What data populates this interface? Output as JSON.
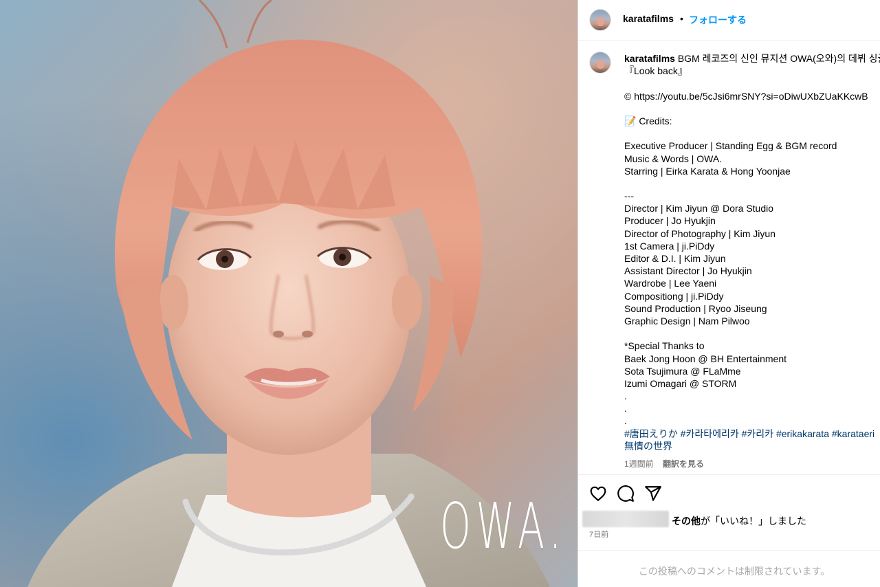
{
  "post": {
    "image_overlay_text": "OWA."
  },
  "header": {
    "username": "karatafilms",
    "separator": "•",
    "follow_label": "フォローする"
  },
  "caption": {
    "username": "karatafilms",
    "first_line": " BGM 레코즈의 신인 뮤지션 OWA(오와)의 데뷔 싱글",
    "lines": [
      "『Look back』",
      "",
      "© https://youtu.be/5cJsi6mrSNY?si=oDiwUXbZUaKKcwB",
      "",
      "📝 Credits:",
      "",
      "Executive Producer | Standing Egg & BGM record",
      "Music & Words | OWA.",
      "Starring | Eirka Karata & Hong Yoonjae",
      "",
      "---",
      "Director | Kim Jiyun @ Dora Studio",
      "Producer | Jo Hyukjin",
      "Director of Photography | Kim Jiyun",
      "1st Camera | ji.PiDdy",
      "Editor & D.I. | Kim Jiyun",
      "Assistant Director | Jo Hyukjin",
      "Wardrobe | Lee Yaeni",
      "Compositiong | ji.PiDdy",
      "Sound Production | Ryoo Jiseung",
      "Graphic Design | Nam Pilwoo",
      "",
      "*Special Thanks to",
      "Baek Jong Hoon @ BH Entertainment",
      "Sota Tsujimura @ FLaMme",
      "Izumi Omagari @ STORM",
      ".",
      ".",
      "."
    ],
    "hashtags": "#唐田えりか #카라타에리카 #카리카 #erikakarata #karataeri",
    "hashtags_line2": "無情の世界",
    "time_ago": "1週間前",
    "translate_label": "翻訳を見る"
  },
  "actions": {
    "like_icon": "heart-icon",
    "comment_icon": "comment-icon",
    "share_icon": "paper-plane-icon"
  },
  "likes": {
    "others_label": "その他",
    "suffix": "が「いいね！」しました",
    "date": "7日前"
  },
  "comments": {
    "limited_message": "この投稿へのコメントは制限されています。"
  },
  "colors": {
    "link_blue": "#0095f6",
    "hashtag_blue": "#00376b",
    "secondary_text": "#737373",
    "muted_text": "#a8a8a8",
    "divider": "#efefef"
  }
}
